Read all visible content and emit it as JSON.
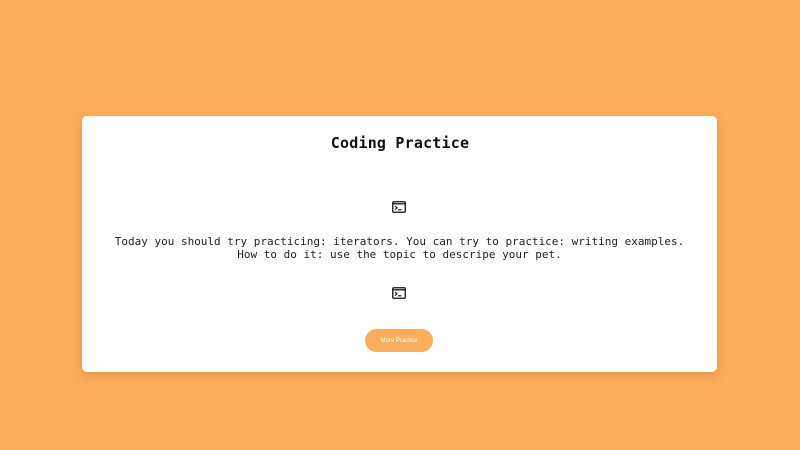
{
  "colors": {
    "background": "#fbae5c",
    "card": "#ffffff",
    "button": "#fbae5c",
    "button_text": "#ffffff",
    "text": "#222222"
  },
  "card": {
    "title": "Coding Practice",
    "icons": [
      "terminal-icon",
      "terminal-icon"
    ],
    "message": "Today you should try practicing: iterators. You can try to practice: writing examples. How to do it: use the topic to descripe your pet.",
    "button_label": "More Practice"
  }
}
